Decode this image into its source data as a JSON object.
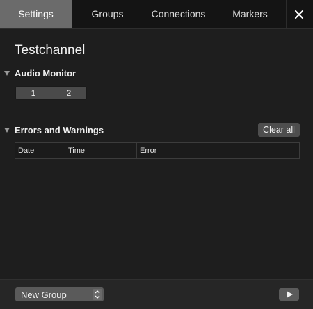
{
  "tabs": [
    {
      "label": "Settings",
      "active": true
    },
    {
      "label": "Groups",
      "active": false
    },
    {
      "label": "Connections",
      "active": false
    },
    {
      "label": "Markers",
      "active": false
    }
  ],
  "close_icon": "close-icon",
  "channel": {
    "title": "Testchannel"
  },
  "audio_monitor": {
    "title": "Audio Monitor",
    "buttons": [
      "1",
      "2"
    ]
  },
  "errors": {
    "title": "Errors and Warnings",
    "clear_label": "Clear all",
    "columns": [
      "Date",
      "Time",
      "Error"
    ],
    "rows": []
  },
  "footer": {
    "group_select_value": "New Group",
    "play_icon": "play-icon"
  },
  "colors": {
    "active_tab": "#6b6b6b",
    "background": "#1e1e1e",
    "button": "#4a4a4a"
  }
}
